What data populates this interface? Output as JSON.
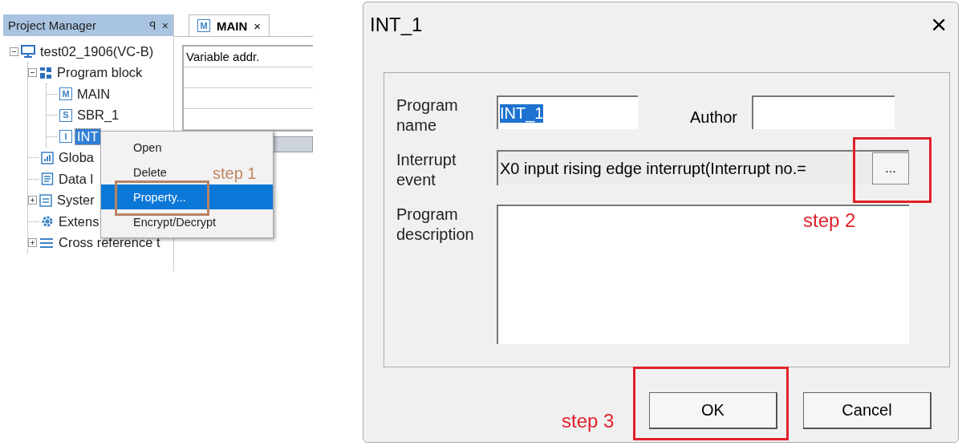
{
  "project_manager": {
    "title": "Project Manager",
    "pin": "ꟼ",
    "close": "×",
    "tree": [
      {
        "label": "test02_1906(VC-B)",
        "kind": "computer",
        "expanded": true,
        "selected": false,
        "children": [
          {
            "label": "Program block",
            "kind": "blocks",
            "expanded": true,
            "selected": false,
            "children": [
              {
                "label": "MAIN",
                "kind": "letter",
                "badge": "M",
                "selected": false
              },
              {
                "label": "SBR_1",
                "kind": "letter",
                "badge": "S",
                "selected": false
              },
              {
                "label": "INT",
                "kind": "letter",
                "badge": "I",
                "selected": true
              }
            ]
          },
          {
            "label": "Globa",
            "kind": "chart",
            "selected": false
          },
          {
            "label": "Data l",
            "kind": "doc",
            "selected": false
          },
          {
            "label": "Syster",
            "kind": "panel",
            "expanded": false,
            "selected": false
          },
          {
            "label": "Extens",
            "kind": "gear",
            "selected": false
          },
          {
            "label": "Cross reference t",
            "kind": "list",
            "expanded": false,
            "selected": false
          }
        ]
      }
    ]
  },
  "editor": {
    "tabs": [
      {
        "label": "MAIN",
        "badge": "M",
        "close": "×",
        "selected": true
      }
    ],
    "table": {
      "header": "Variable addr."
    }
  },
  "context_menu": [
    {
      "label": "Open",
      "selected": false
    },
    {
      "label": "Delete",
      "selected": false
    },
    {
      "label": "Property...",
      "selected": true
    },
    {
      "label": "Encrypt/Decrypt",
      "selected": false
    }
  ],
  "dialog": {
    "title": "INT_1",
    "close": "×",
    "program_name": {
      "label": "Program name",
      "value": "INT_1",
      "selected": true
    },
    "author": {
      "label": "Author"
    },
    "interrupt_event": {
      "label": "Interrupt event",
      "value": "X0 input rising edge interrupt(Interrupt no.=",
      "button": "..."
    },
    "program_description": {
      "label": "Program description"
    },
    "buttons": [
      {
        "label": "OK"
      },
      {
        "label": "Cancel"
      }
    ]
  },
  "annotations": [
    {
      "label": "step 1",
      "color": "#c08562"
    },
    {
      "label": "step 2",
      "color": "#e0202a"
    },
    {
      "label": "step 3",
      "color": "#e0202a"
    }
  ]
}
